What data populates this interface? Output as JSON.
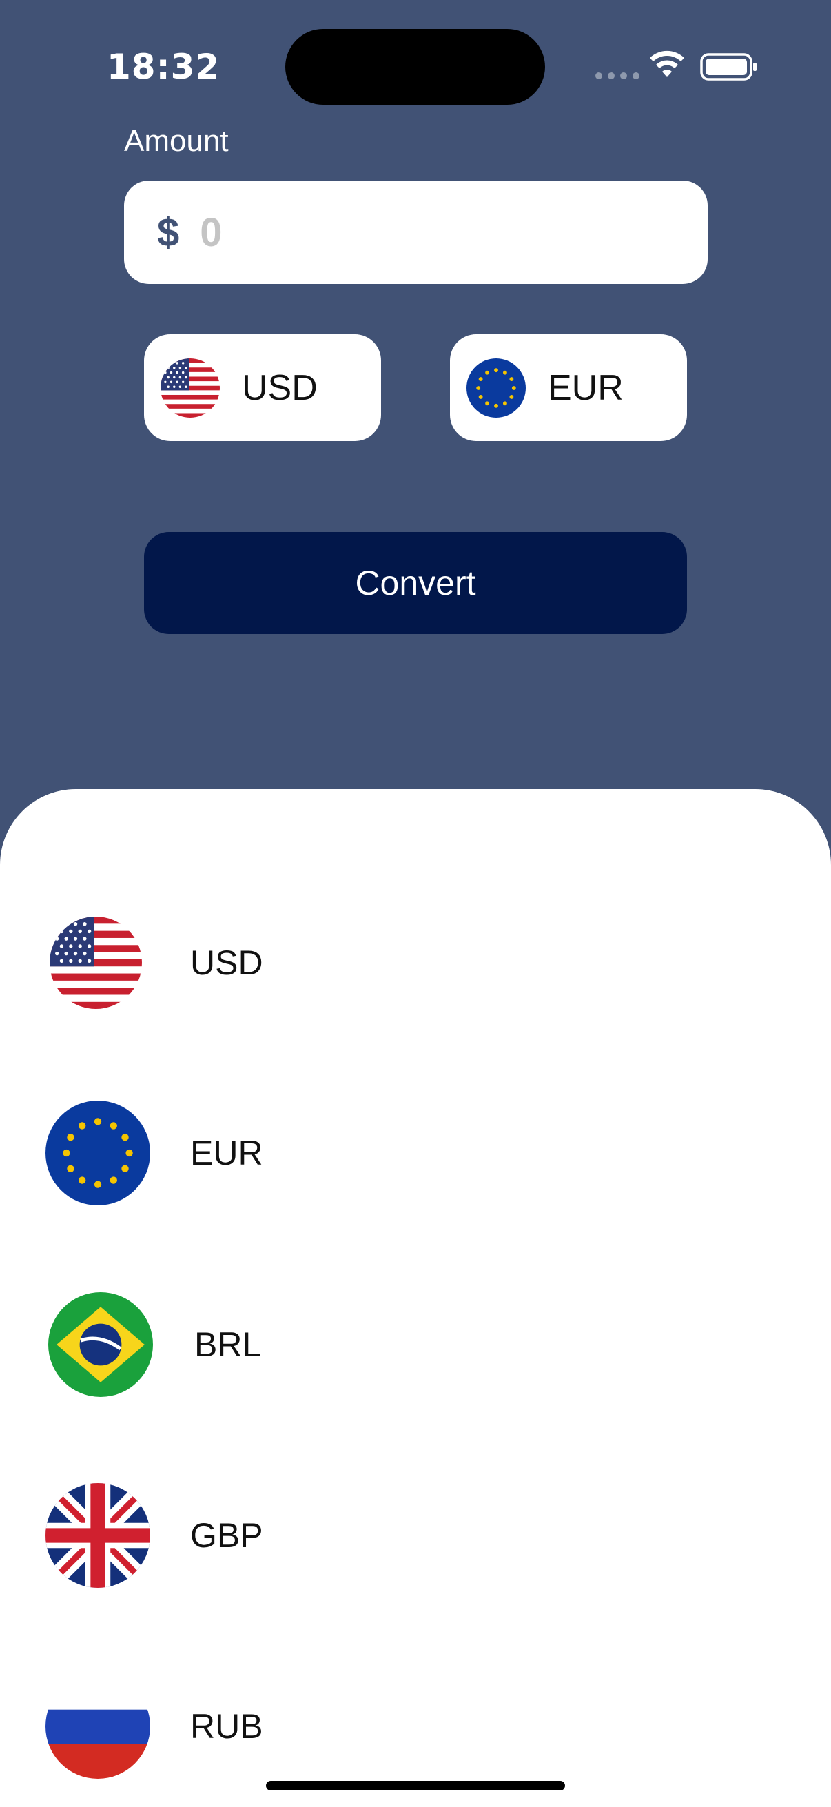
{
  "status_bar": {
    "time": "18:32"
  },
  "amount": {
    "label": "Amount",
    "currency_symbol": "$",
    "placeholder": "0",
    "value": ""
  },
  "selector": {
    "from": {
      "code": "USD",
      "icon": "us-flag-icon"
    },
    "to": {
      "code": "EUR",
      "icon": "eu-flag-icon"
    }
  },
  "convert_button": {
    "label": "Convert"
  },
  "currency_list": [
    {
      "code": "USD",
      "icon": "us-flag-icon"
    },
    {
      "code": "EUR",
      "icon": "eu-flag-icon"
    },
    {
      "code": "BRL",
      "icon": "br-flag-icon"
    },
    {
      "code": "GBP",
      "icon": "uk-flag-icon"
    },
    {
      "code": "RUB",
      "icon": "ru-flag-icon"
    }
  ],
  "colors": {
    "background": "#415275",
    "convert_button": "#02174a",
    "placeholder": "#c4c4c4"
  }
}
